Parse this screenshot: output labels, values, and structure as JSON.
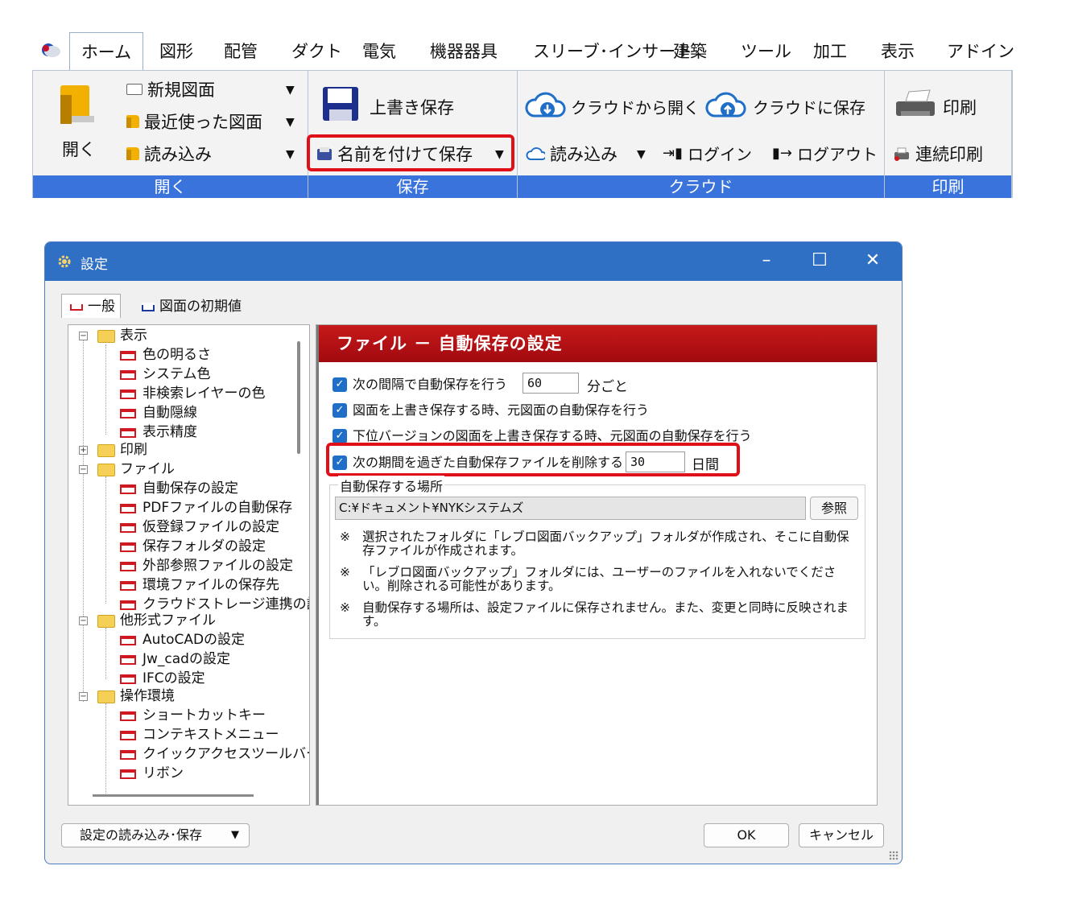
{
  "ribbon": {
    "tabs": [
      "ホーム",
      "図形",
      "配管",
      "ダクト",
      "電気",
      "機器器具",
      "スリーブ･インサート",
      "建築",
      "ツール",
      "加工",
      "表示",
      "アドイン"
    ],
    "open_group": {
      "open_label": "開く",
      "new_drawing": "新規図面",
      "recent": "最近使った図面",
      "import": "読み込み",
      "group_label": "開く"
    },
    "save_group": {
      "overwrite_save": "上書き保存",
      "save_as": "名前を付けて保存",
      "group_label": "保存"
    },
    "cloud_group": {
      "open_from_cloud": "クラウドから開く",
      "save_to_cloud": "クラウドに保存",
      "import": "読み込み",
      "login": "ログイン",
      "logout": "ログアウト",
      "group_label": "クラウド"
    },
    "print_group": {
      "print": "印刷",
      "batch_print": "連続印刷",
      "group_label": "印刷"
    },
    "colors": {
      "group_label_bg": "#3a73db",
      "highlight": "#e0101a"
    }
  },
  "dialog": {
    "title": "設定",
    "tabs": [
      "一般",
      "図面の初期値"
    ],
    "tree": {
      "display": "表示",
      "display_children": [
        "色の明るさ",
        "システム色",
        "非検索レイヤーの色",
        "自動隠線",
        "表示精度"
      ],
      "print": "印刷",
      "file": "ファイル",
      "file_children": [
        "自動保存の設定",
        "PDFファイルの自動保存",
        "仮登録ファイルの設定",
        "保存フォルダの設定",
        "外部参照ファイルの設定",
        "環境ファイルの保存先",
        "クラウドストレージ連携の設"
      ],
      "other_formats": "他形式ファイル",
      "other_children": [
        "AutoCADの設定",
        "Jw_cadの設定",
        "IFCの設定"
      ],
      "operation": "操作環境",
      "operation_children": [
        "ショートカットキー",
        "コンテキストメニュー",
        "クイックアクセスツールバー",
        "リボン"
      ]
    },
    "panel": {
      "header": "ファイル － 自動保存の設定",
      "opt1_text": "次の間隔で自動保存を行う",
      "opt1_value": "60",
      "opt1_unit": "分ごと",
      "opt2_text": "図面を上書き保存する時、元図面の自動保存を行う",
      "opt3_text": "下位バージョンの図面を上書き保存する時、元図面の自動保存を行う",
      "opt4_text": "次の期間を過ぎた自動保存ファイルを削除する",
      "opt4_value": "30",
      "opt4_unit": "日間",
      "location_label": "自動保存する場所",
      "location_path": "C:¥ドキュメント¥NYKシステムズ",
      "browse": "参照",
      "note_mark": "※",
      "note1": "選択されたフォルダに「レブロ図面バックアップ」フォルダが作成され、そこに自動保存ファイルが作成されます。",
      "note2": "「レブロ図面バックアップ」フォルダには、ユーザーのファイルを入れないでください。削除される可能性があります。",
      "note3": "自動保存する場所は、設定ファイルに保存されません。また、変更と同時に反映されます。"
    },
    "footer": {
      "load_save": "設定の読み込み･保存",
      "ok": "OK",
      "cancel": "キャンセル"
    },
    "colors": {
      "titlebar": "#2f6fc4",
      "header": "#b0121a",
      "checkbox": "#1f6fc8"
    }
  }
}
